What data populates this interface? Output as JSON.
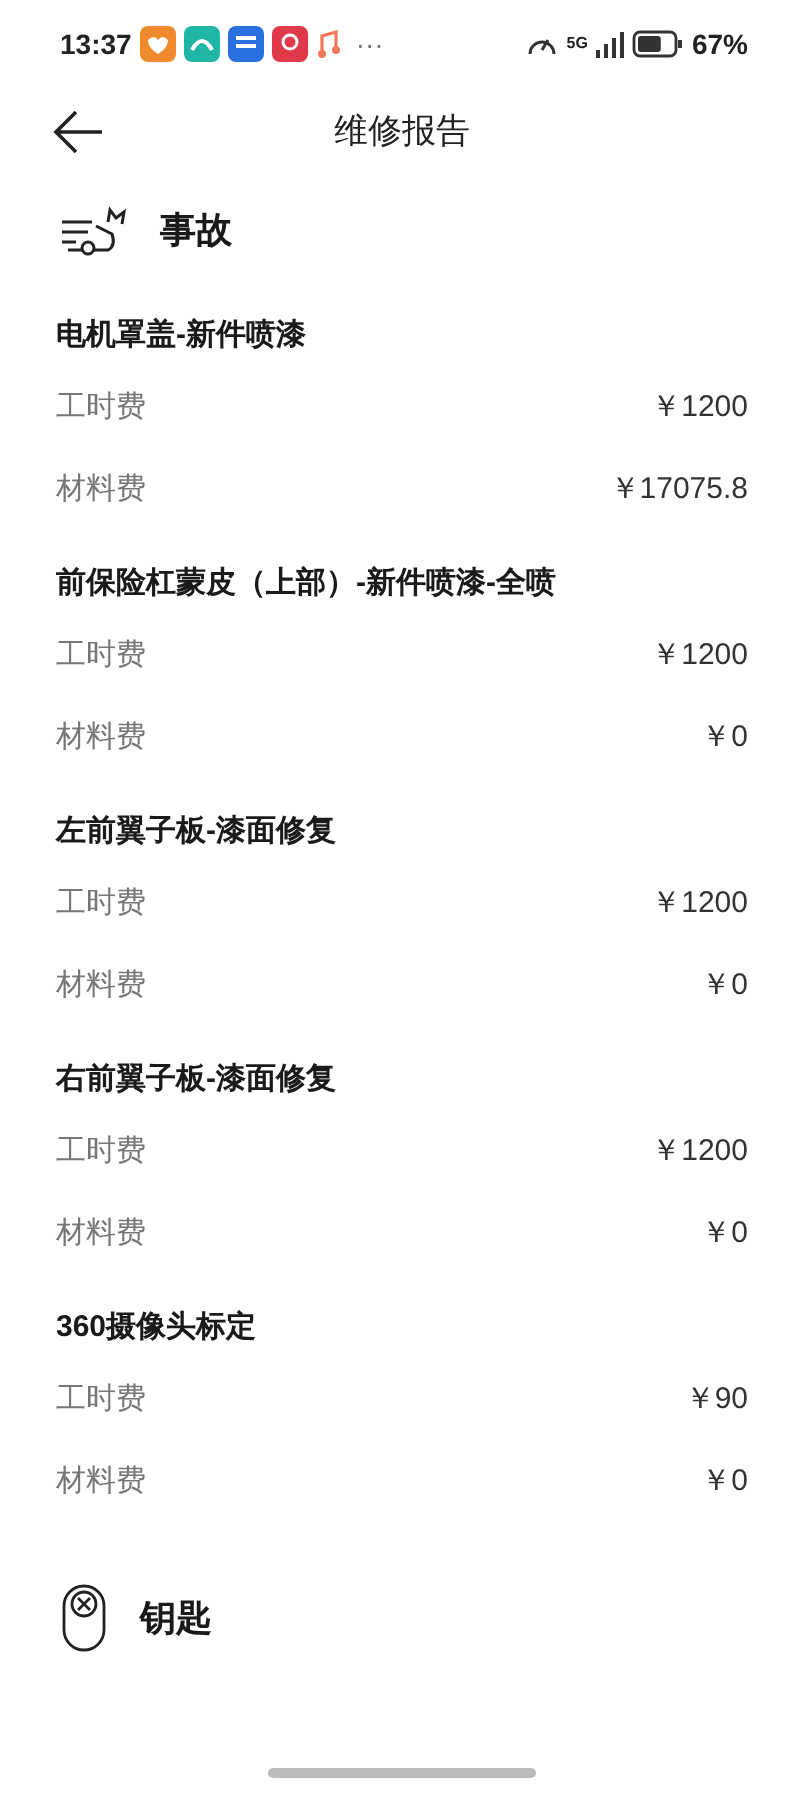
{
  "status_bar": {
    "time": "13:37",
    "more": "···",
    "network": "5G",
    "battery": "67%"
  },
  "header": {
    "title": "维修报告"
  },
  "sections": [
    {
      "kind": "accident",
      "title": "事故",
      "items": [
        {
          "name": "电机罩盖-新件喷漆",
          "fees": [
            {
              "label": "工时费",
              "amount": "￥1200"
            },
            {
              "label": "材料费",
              "amount": "￥17075.8"
            }
          ]
        },
        {
          "name": "前保险杠蒙皮（上部）-新件喷漆-全喷",
          "fees": [
            {
              "label": "工时费",
              "amount": "￥1200"
            },
            {
              "label": "材料费",
              "amount": "￥0"
            }
          ]
        },
        {
          "name": "左前翼子板-漆面修复",
          "fees": [
            {
              "label": "工时费",
              "amount": "￥1200"
            },
            {
              "label": "材料费",
              "amount": "￥0"
            }
          ]
        },
        {
          "name": "右前翼子板-漆面修复",
          "fees": [
            {
              "label": "工时费",
              "amount": "￥1200"
            },
            {
              "label": "材料费",
              "amount": "￥0"
            }
          ]
        },
        {
          "name": "360摄像头标定",
          "fees": [
            {
              "label": "工时费",
              "amount": "￥90"
            },
            {
              "label": "材料费",
              "amount": "￥0"
            }
          ]
        }
      ]
    },
    {
      "kind": "key",
      "title": "钥匙"
    }
  ]
}
